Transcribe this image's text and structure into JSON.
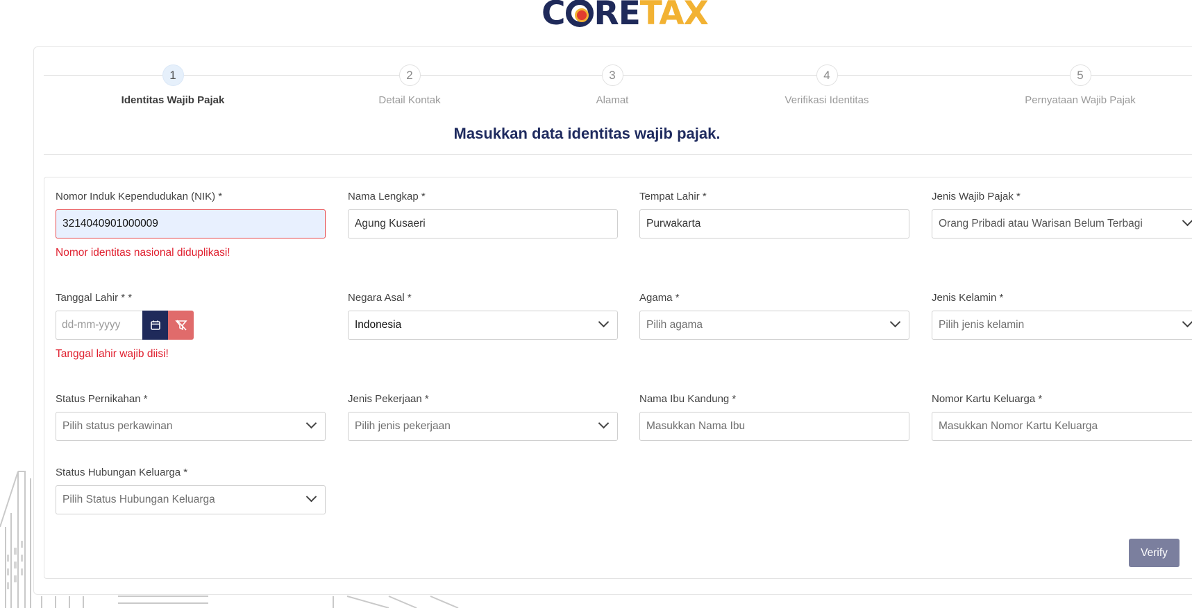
{
  "logo": {
    "part1": "C",
    "part2": "RE",
    "part3": "TAX"
  },
  "stepper": {
    "steps": [
      {
        "number": "1",
        "label": "Identitas Wajib Pajak"
      },
      {
        "number": "2",
        "label": "Detail Kontak"
      },
      {
        "number": "3",
        "label": "Alamat"
      },
      {
        "number": "4",
        "label": "Verifikasi Identitas"
      },
      {
        "number": "5",
        "label": "Pernyataan Wajib Pajak"
      }
    ],
    "active_step": 1
  },
  "form": {
    "heading": "Masukkan data identitas wajib pajak.",
    "fields": {
      "nik": {
        "label": "Nomor Induk Kependudukan (NIK) *",
        "value": "3214040901000009",
        "error": "Nomor identitas nasional diduplikasi!"
      },
      "nama_lengkap": {
        "label": "Nama Lengkap *",
        "value": "Agung Kusaeri"
      },
      "tempat_lahir": {
        "label": "Tempat Lahir *",
        "value": "Purwakarta"
      },
      "jenis_wajib_pajak": {
        "label": "Jenis Wajib Pajak *",
        "value": "Orang Pribadi atau Warisan Belum Terbagi"
      },
      "tanggal_lahir": {
        "label": "Tanggal Lahir * *",
        "placeholder": "dd-mm-yyyy",
        "error": "Tanggal lahir wajib diisi!"
      },
      "negara_asal": {
        "label": "Negara Asal *",
        "value": "Indonesia"
      },
      "agama": {
        "label": "Agama *",
        "placeholder": "Pilih agama"
      },
      "jenis_kelamin": {
        "label": "Jenis Kelamin *",
        "placeholder": "Pilih jenis kelamin"
      },
      "status_pernikahan": {
        "label": "Status Pernikahan *",
        "placeholder": "Pilih status perkawinan"
      },
      "jenis_pekerjaan": {
        "label": "Jenis Pekerjaan *",
        "placeholder": "Pilih jenis pekerjaan"
      },
      "nama_ibu": {
        "label": "Nama Ibu Kandung *",
        "placeholder": "Masukkan Nama Ibu"
      },
      "nomor_kk": {
        "label": "Nomor Kartu Keluarga *",
        "placeholder": "Masukkan Nomor Kartu Keluarga"
      },
      "status_hubungan": {
        "label": "Status Hubungan Keluarga *",
        "placeholder": "Pilih Status Hubungan Keluarga"
      }
    },
    "verify_label": "Verify"
  },
  "colors": {
    "primary": "#1f2a5a",
    "error": "#e0202f",
    "accent_yellow": "#f2b233",
    "verify_disabled": "#7b7f9e"
  }
}
